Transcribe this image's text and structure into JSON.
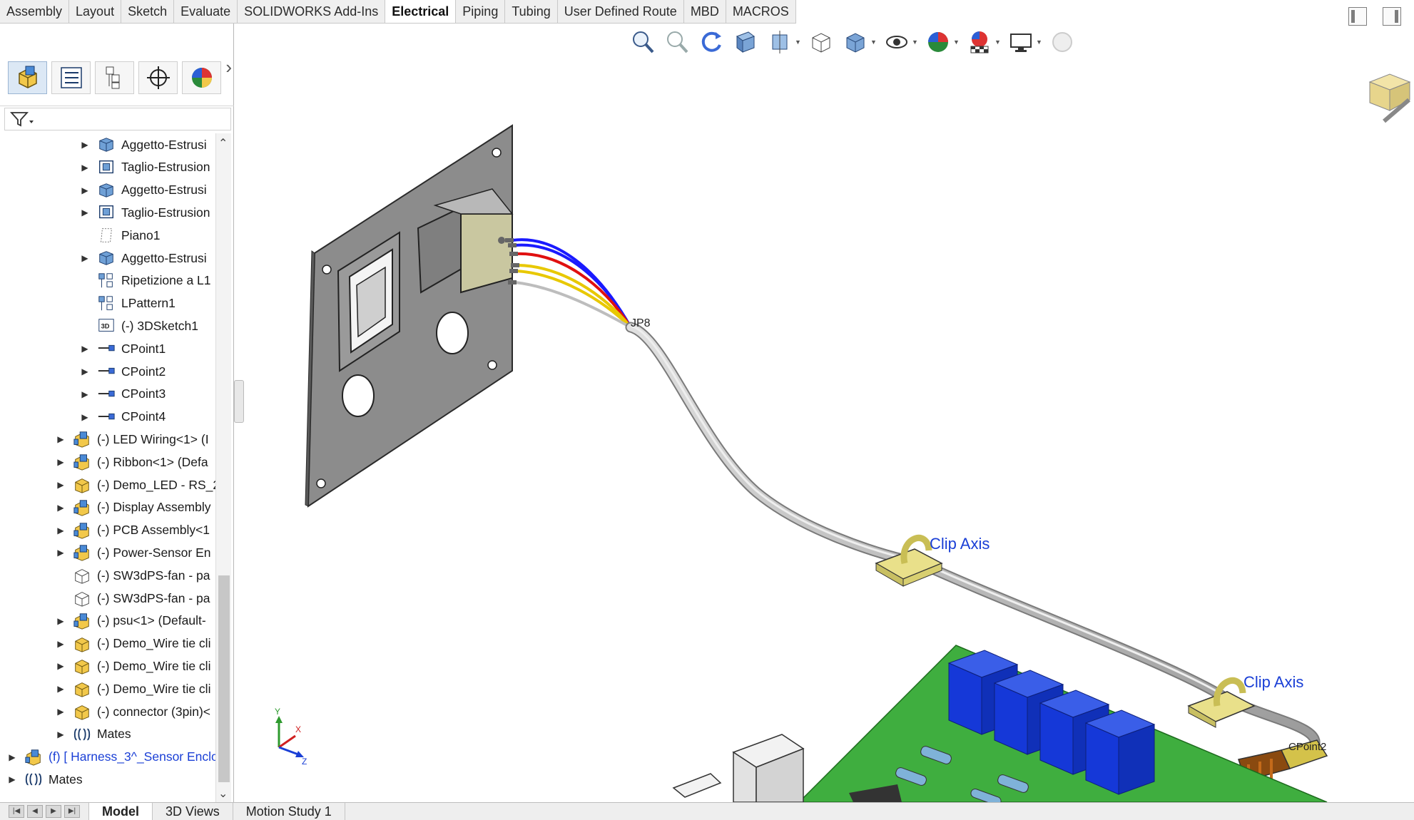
{
  "command_tabs": [
    {
      "label": "Assembly",
      "active": false
    },
    {
      "label": "Layout",
      "active": false
    },
    {
      "label": "Sketch",
      "active": false
    },
    {
      "label": "Evaluate",
      "active": false
    },
    {
      "label": "SOLIDWORKS Add-Ins",
      "active": false
    },
    {
      "label": "Electrical",
      "active": true
    },
    {
      "label": "Piping",
      "active": false
    },
    {
      "label": "Tubing",
      "active": false
    },
    {
      "label": "User Defined Route",
      "active": false
    },
    {
      "label": "MBD",
      "active": false
    },
    {
      "label": "MACROS",
      "active": false
    }
  ],
  "panel_tabs": [
    {
      "name": "featuremanager-tab",
      "icon": "assembly-icon",
      "active": true
    },
    {
      "name": "propertymanager-tab",
      "icon": "property-list-icon",
      "active": false
    },
    {
      "name": "configuration-tab",
      "icon": "configuration-icon",
      "active": false
    },
    {
      "name": "dimxpert-tab",
      "icon": "crosshair-icon",
      "active": false
    },
    {
      "name": "display-tab",
      "icon": "appearance-sphere-icon",
      "active": false
    }
  ],
  "tree": [
    {
      "label": "Aggetto-Estrusi",
      "icon": "extrude-icon",
      "expand": true,
      "level": 2
    },
    {
      "label": "Taglio-Estrusion",
      "icon": "cut-extrude-icon",
      "expand": true,
      "level": 2
    },
    {
      "label": "Aggetto-Estrusi",
      "icon": "extrude-icon",
      "expand": true,
      "level": 2
    },
    {
      "label": "Taglio-Estrusion",
      "icon": "cut-extrude-icon",
      "expand": true,
      "level": 2
    },
    {
      "label": "Piano1",
      "icon": "plane-icon",
      "expand": false,
      "level": 2
    },
    {
      "label": "Aggetto-Estrusi",
      "icon": "extrude-icon",
      "expand": true,
      "level": 2
    },
    {
      "label": "Ripetizione a L1",
      "icon": "linear-pattern-icon",
      "expand": false,
      "level": 2
    },
    {
      "label": "LPattern1",
      "icon": "linear-pattern-icon",
      "expand": false,
      "level": 2
    },
    {
      "label": "(-) 3DSketch1",
      "icon": "3d-sketch-icon",
      "expand": false,
      "level": 2
    },
    {
      "label": "CPoint1",
      "icon": "connection-point-icon",
      "expand": true,
      "level": 2
    },
    {
      "label": "CPoint2",
      "icon": "connection-point-icon",
      "expand": true,
      "level": 2
    },
    {
      "label": "CPoint3",
      "icon": "connection-point-icon",
      "expand": true,
      "level": 2
    },
    {
      "label": "CPoint4",
      "icon": "connection-point-icon",
      "expand": true,
      "level": 2
    },
    {
      "label": "(-) LED Wiring<1> (I",
      "icon": "subassembly-icon",
      "expand": true,
      "level": 1
    },
    {
      "label": "(-) Ribbon<1> (Defa",
      "icon": "subassembly-icon",
      "expand": true,
      "level": 1
    },
    {
      "label": "(-) Demo_LED - RS_2",
      "icon": "part-icon",
      "expand": true,
      "level": 1
    },
    {
      "label": "(-) Display Assembly",
      "icon": "subassembly-icon",
      "expand": true,
      "level": 1
    },
    {
      "label": "(-) PCB Assembly<1",
      "icon": "subassembly-icon",
      "expand": true,
      "level": 1
    },
    {
      "label": "(-) Power-Sensor En",
      "icon": "subassembly-icon",
      "expand": true,
      "level": 1
    },
    {
      "label": "(-) SW3dPS-fan - pa",
      "icon": "part-outline-icon",
      "expand": false,
      "level": 1
    },
    {
      "label": "(-) SW3dPS-fan - pa",
      "icon": "part-outline-icon",
      "expand": false,
      "level": 1
    },
    {
      "label": "(-) psu<1> (Default-",
      "icon": "subassembly-icon",
      "expand": true,
      "level": 1
    },
    {
      "label": "(-) Demo_Wire tie cli",
      "icon": "part-icon",
      "expand": true,
      "level": 1
    },
    {
      "label": "(-) Demo_Wire tie cli",
      "icon": "part-icon",
      "expand": true,
      "level": 1
    },
    {
      "label": "(-) Demo_Wire tie cli",
      "icon": "part-icon",
      "expand": true,
      "level": 1
    },
    {
      "label": "(-) connector (3pin)<",
      "icon": "part-icon",
      "expand": true,
      "level": 1
    },
    {
      "label": "Mates",
      "icon": "mates-icon",
      "expand": true,
      "level": 1
    },
    {
      "label": "(f) [ Harness_3^_Sensor Enclo",
      "icon": "subassembly-icon",
      "expand": true,
      "level": 0,
      "blue": true
    },
    {
      "label": "Mates",
      "icon": "mates-icon",
      "expand": true,
      "level": 0
    }
  ],
  "bottom_tabs": [
    {
      "label": "Model",
      "active": true
    },
    {
      "label": "3D Views",
      "active": false
    },
    {
      "label": "Motion Study 1",
      "active": false
    }
  ],
  "hud_buttons": [
    {
      "name": "zoom-to-fit-icon",
      "dropdown": false
    },
    {
      "name": "zoom-to-area-icon",
      "dropdown": false
    },
    {
      "name": "previous-view-icon",
      "dropdown": false
    },
    {
      "name": "section-view-icon",
      "dropdown": false
    },
    {
      "name": "view-orientation-icon",
      "dropdown": true
    },
    {
      "name": "display-style-wire-icon",
      "dropdown": false
    },
    {
      "name": "display-style-icon",
      "dropdown": true
    },
    {
      "name": "hide-show-items-icon",
      "dropdown": true
    },
    {
      "name": "edit-appearance-icon",
      "dropdown": true
    },
    {
      "name": "apply-scene-icon",
      "dropdown": true
    },
    {
      "name": "view-settings-icon",
      "dropdown": true
    },
    {
      "name": "realview-icon",
      "dropdown": false
    }
  ],
  "viewport": {
    "labels": {
      "jp8": "JP8",
      "clip_axis_1": "Clip Axis",
      "clip_axis_2": "Clip Axis",
      "cpoint2": "CPoint2"
    },
    "triad": {
      "x": "X",
      "y": "Y",
      "z": "Z"
    },
    "wire_colors": [
      "#1a1aff",
      "#1a1aff",
      "#e01010",
      "#e8c800",
      "#e8c800",
      "#bdbdbd"
    ],
    "pcb_color": "#3fae3f",
    "component_color": "#1538d8",
    "cable_color": "#bcbcbc",
    "clip_color": "#e9e08a"
  }
}
